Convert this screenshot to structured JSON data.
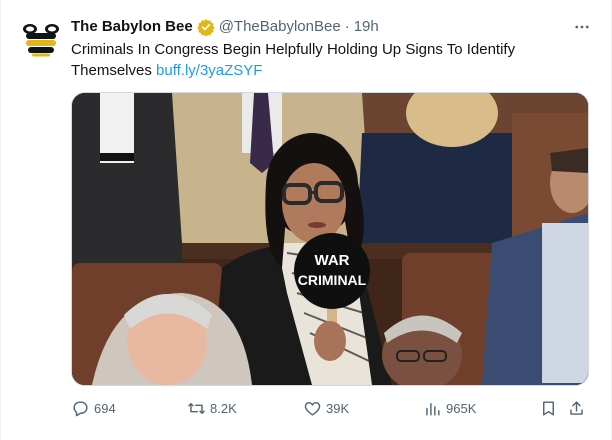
{
  "colors": {
    "link": "#1d9bf0",
    "muted": "#536471",
    "verified_gold": "#e2b719",
    "text": "#0f1419"
  },
  "tweet": {
    "author_name": "The Babylon Bee",
    "handle": "@TheBabylonBee",
    "separator": "·",
    "time": "19h",
    "text": "Criminals In Congress Begin Helpfully Holding Up Signs To Identify Themselves",
    "link": "buff.ly/3yaZSYF",
    "avatar_icon": "babylon-bee-logo",
    "verified_icon": "gold-verified-badge",
    "more_icon": "more-horizontal-icon"
  },
  "media": {
    "sign_line1": "WAR",
    "sign_line2": "CRIMINAL"
  },
  "actions": {
    "replies": "694",
    "reposts": "8.2K",
    "likes": "39K",
    "views": "965K",
    "bookmark_icon": "bookmark-icon",
    "share_icon": "share-icon"
  }
}
